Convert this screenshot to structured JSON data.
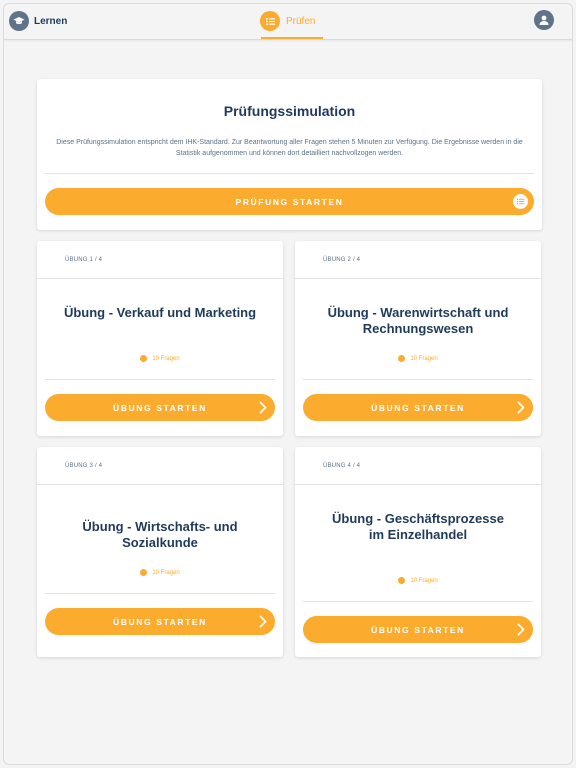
{
  "nav": {
    "learn_label": "Lernen",
    "test_label": "Prüfen"
  },
  "colors": {
    "accent": "#fbab2e",
    "navy": "#1f3a5a",
    "slate": "#5f7389",
    "background": "#f4f4f4"
  },
  "exam": {
    "title": "Prüfungssimulation",
    "description": "Diese Prüfungssimulation entspricht dem IHK-Standard. Zur Beantwortung aller Fragen stehen 5 Minuten zur Verfügung. Die Ergebnisse werden in die Statistik aufgenommen und können dort detailliert nachvollzogen werden.",
    "button_label": "PRÜFUNG STARTEN",
    "button_icon": "list-icon"
  },
  "exercises": [
    {
      "tag": "ÜBUNG 1 / 4",
      "title": "Übung - Verkauf und Marketing",
      "count": "10 Fragen",
      "button_label": "ÜBUNG STARTEN"
    },
    {
      "tag": "ÜBUNG 2 / 4",
      "title": "Übung - Warenwirtschaft und Rechnungswesen",
      "count": "10 Fragen",
      "button_label": "ÜBUNG STARTEN"
    },
    {
      "tag": "ÜBUNG 3 / 4",
      "title": "Übung - Wirtschafts- und Sozialkunde",
      "count": "10 Fragen",
      "button_label": "ÜBUNG STARTEN"
    },
    {
      "tag": "ÜBUNG 4 / 4",
      "title": "Übung - Geschäftsprozesse im Einzelhandel",
      "count": "10 Fragen",
      "button_label": "ÜBUNG STARTEN"
    }
  ]
}
